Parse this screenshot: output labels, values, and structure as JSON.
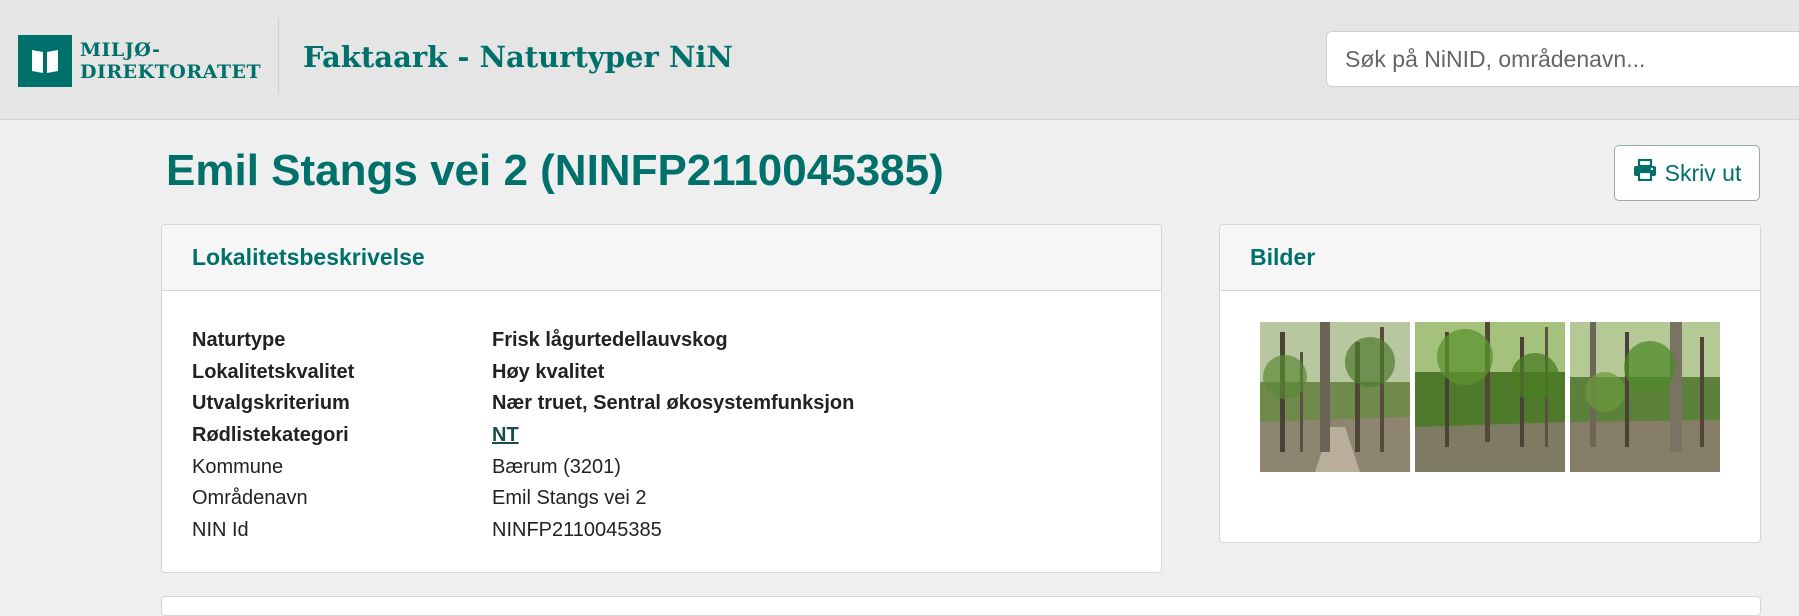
{
  "header": {
    "logo_line1": "MILJØ-",
    "logo_line2": "DIREKTORATET",
    "app_title": "Faktaark - Naturtyper NiN",
    "search_placeholder": "Søk på NiNID, områdenavn..."
  },
  "page": {
    "title": "Emil Stangs vei 2 (NINFP2110045385)",
    "print_label": "Skriv ut"
  },
  "description": {
    "heading": "Lokalitetsbeskrivelse",
    "rows": [
      {
        "label": "Naturtype",
        "value": "Frisk lågurtedellauvskog"
      },
      {
        "label": "Lokalitetskvalitet",
        "value": "Høy kvalitet"
      },
      {
        "label": "Utvalgskriterium",
        "value": "Nær truet, Sentral økosystemfunksjon"
      },
      {
        "label": "Rødlistekategori",
        "value": "NT"
      },
      {
        "label": "Kommune",
        "value": "Bærum (3201)"
      },
      {
        "label": "Områdenavn",
        "value": "Emil Stangs vei 2"
      },
      {
        "label": "NIN Id",
        "value": "NINFP2110045385"
      }
    ]
  },
  "images": {
    "heading": "Bilder",
    "items": [
      "forest-photo",
      "forest-photo",
      "forest-photo"
    ]
  },
  "colors": {
    "brand": "#00706b",
    "background": "#efefef",
    "header": "#e5e5e5"
  }
}
